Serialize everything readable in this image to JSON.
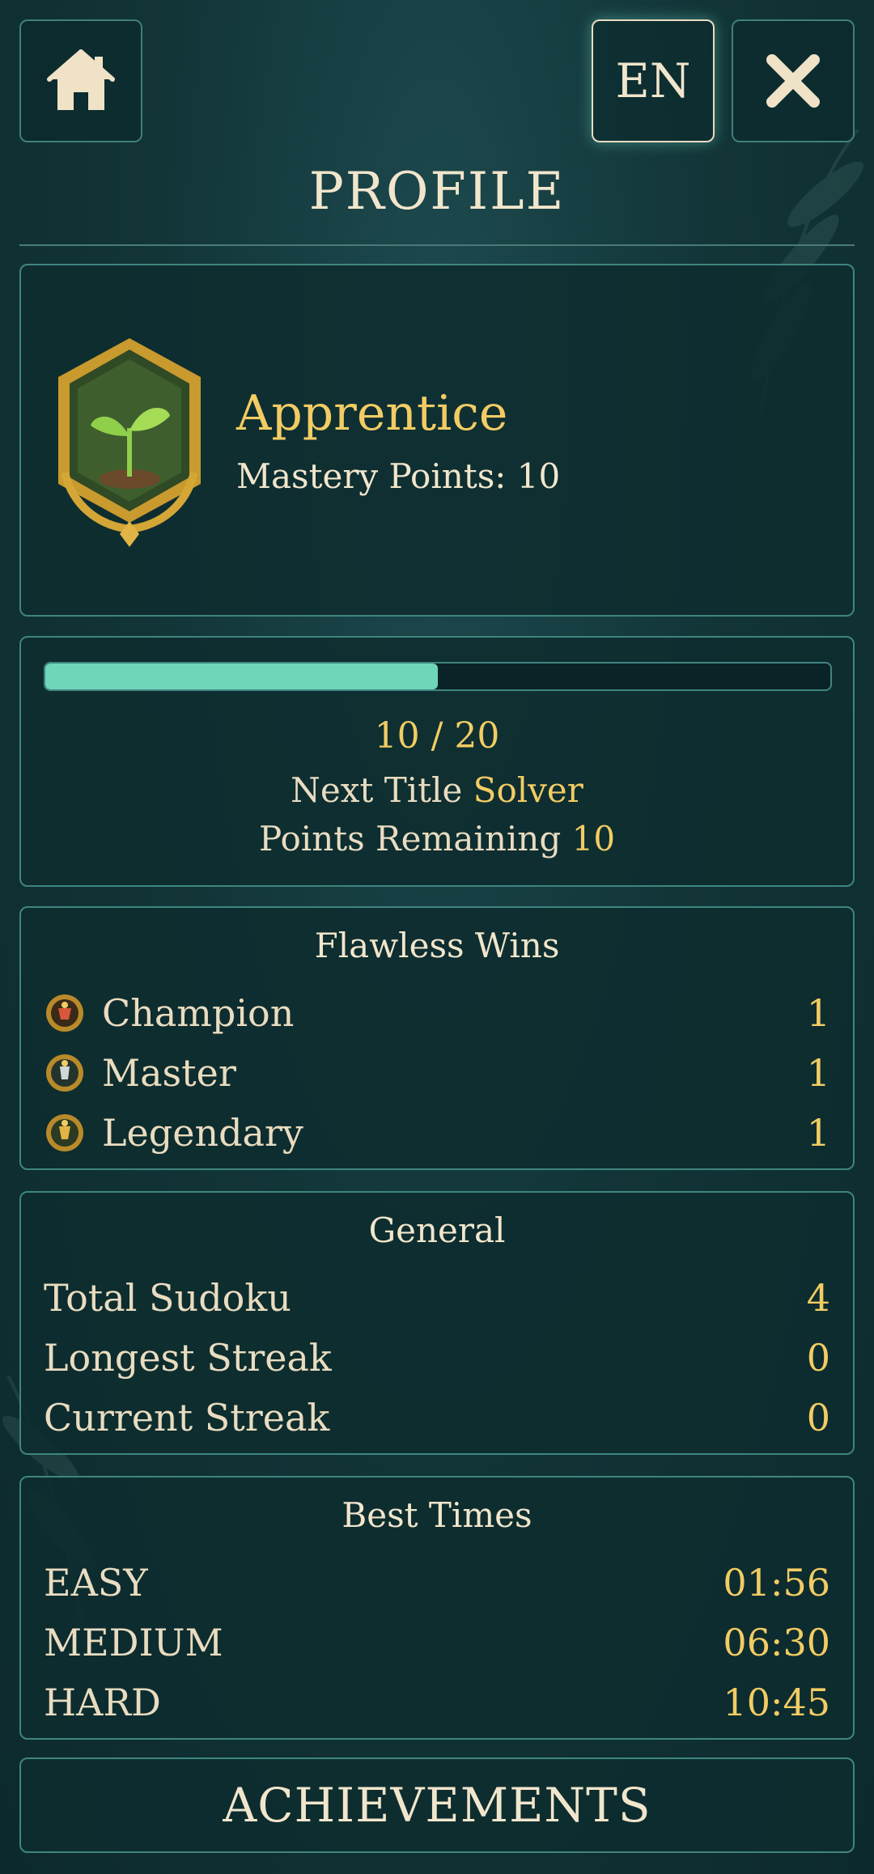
{
  "header": {
    "language": "EN",
    "title": "PROFILE"
  },
  "rank": {
    "name": "Apprentice",
    "points_label": "Mastery Points: 10"
  },
  "progress": {
    "current": 10,
    "target": 20,
    "fraction": 0.5,
    "count_text": "10 / 20",
    "next_title_label": "Next Title",
    "next_title_value": "Solver",
    "remaining_label": "Points Remaining",
    "remaining_value": "10"
  },
  "flawless": {
    "title": "Flawless Wins",
    "rows": [
      {
        "label": "Champion",
        "value": "1",
        "icon": "champion-medal-icon"
      },
      {
        "label": "Master",
        "value": "1",
        "icon": "master-medal-icon"
      },
      {
        "label": "Legendary",
        "value": "1",
        "icon": "legendary-medal-icon"
      }
    ]
  },
  "general": {
    "title": "General",
    "rows": [
      {
        "label": "Total Sudoku",
        "value": "4"
      },
      {
        "label": "Longest Streak",
        "value": "0"
      },
      {
        "label": "Current Streak",
        "value": "0"
      }
    ]
  },
  "best_times": {
    "title": "Best Times",
    "rows": [
      {
        "label": "EASY",
        "value": "01:56"
      },
      {
        "label": "MEDIUM",
        "value": "06:30"
      },
      {
        "label": "HARD",
        "value": "10:45"
      }
    ]
  },
  "achievements_label": "ACHIEVEMENTS",
  "colors": {
    "background": "#123538",
    "accent_gold": "#f2cc63",
    "progress_fill": "#6fd7b9",
    "border": "#3f8580"
  }
}
